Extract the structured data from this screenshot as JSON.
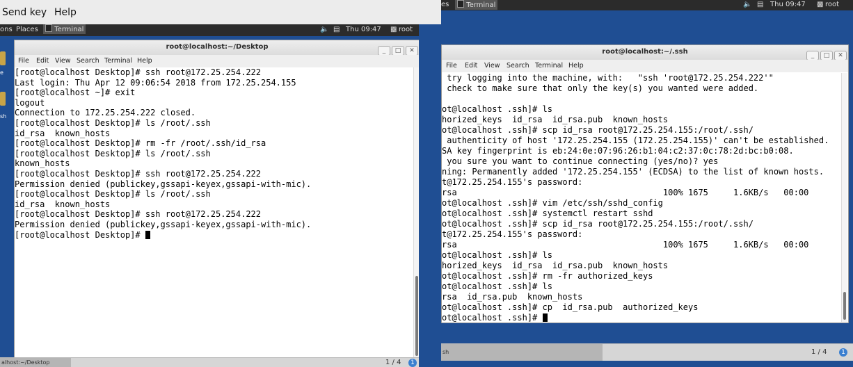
{
  "left_vm": {
    "menubar": {
      "send_key": "Send key",
      "help": "Help"
    },
    "panel": {
      "apps": "ons",
      "places": "Places",
      "terminal": "Terminal",
      "volume_icon": "volume-icon",
      "network_icon": "network-icon",
      "clock": "Thu 09:47",
      "user": "root"
    },
    "desktop_labels": [
      "e",
      "sh"
    ],
    "window": {
      "title": "root@localhost:~/Desktop",
      "menus": [
        "File",
        "Edit",
        "View",
        "Search",
        "Terminal",
        "Help"
      ],
      "lines": [
        "[root@localhost Desktop]# ssh root@172.25.254.222",
        "Last login: Thu Apr 12 09:06:54 2018 from 172.25.254.155",
        "[root@localhost ~]# exit",
        "logout",
        "Connection to 172.25.254.222 closed.",
        "[root@localhost Desktop]# ls /root/.ssh",
        "id_rsa  known_hosts",
        "[root@localhost Desktop]# rm -fr /root/.ssh/id_rsa",
        "[root@localhost Desktop]# ls /root/.ssh",
        "known_hosts",
        "[root@localhost Desktop]# ssh root@172.25.254.222",
        "Permission denied (publickey,gssapi-keyex,gssapi-with-mic).",
        "[root@localhost Desktop]# ls /root/.ssh",
        "id_rsa  known_hosts",
        "[root@localhost Desktop]# ssh root@172.25.254.222",
        "Permission denied (publickey,gssapi-keyex,gssapi-with-mic)."
      ],
      "prompt": "[root@localhost Desktop]# "
    },
    "taskbar": {
      "task": "alhost:~/Desktop",
      "pager": "1 / 4",
      "notif": "1"
    }
  },
  "right_vm": {
    "panel": {
      "apps": "es",
      "terminal": "Terminal",
      "volume_icon": "volume-icon",
      "network_icon": "network-icon",
      "clock": "Thu 09:47",
      "user": "root"
    },
    "window": {
      "title": "root@localhost:~/.ssh",
      "menus": [
        "File",
        "Edit",
        "View",
        "Search",
        "Terminal",
        "Help"
      ],
      "lines": [
        " try logging into the machine, with:   \"ssh 'root@172.25.254.222'\"",
        " check to make sure that only the key(s) you wanted were added.",
        "",
        "ot@localhost .ssh]# ls",
        "horized_keys  id_rsa  id_rsa.pub  known_hosts",
        "ot@localhost .ssh]# scp id_rsa root@172.25.254.155:/root/.ssh/",
        " authenticity of host '172.25.254.155 (172.25.254.155)' can't be established.",
        "SA key fingerprint is eb:24:0e:07:96:26:b1:04:c2:37:0c:78:2d:bc:b0:08.",
        " you sure you want to continue connecting (yes/no)? yes",
        "ning: Permanently added '172.25.254.155' (ECDSA) to the list of known hosts.",
        "t@172.25.254.155's password:",
        "rsa                                         100% 1675     1.6KB/s   00:00",
        "ot@localhost .ssh]# vim /etc/ssh/sshd_config",
        "ot@localhost .ssh]# systemctl restart sshd",
        "ot@localhost .ssh]# scp id_rsa root@172.25.254.155:/root/.ssh/",
        "t@172.25.254.155's password:",
        "rsa                                         100% 1675     1.6KB/s   00:00",
        "ot@localhost .ssh]# ls",
        "horized_keys  id_rsa  id_rsa.pub  known_hosts",
        "ot@localhost .ssh]# rm -fr authorized_keys",
        "ot@localhost .ssh]# ls",
        "rsa  id_rsa.pub  known_hosts",
        "ot@localhost .ssh]# cp  id_rsa.pub  authorized_keys"
      ],
      "prompt": "ot@localhost .ssh]# "
    },
    "taskbar": {
      "task": "sh",
      "pager": "1 / 4",
      "notif": "1"
    }
  },
  "colors": {
    "desktop": "#1f4e93",
    "panel": "#2b2b2b",
    "terminal_bg": "#ffffff",
    "terminal_fg": "#000000"
  }
}
